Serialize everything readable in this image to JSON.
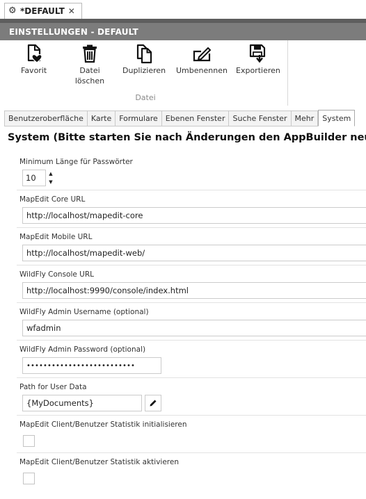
{
  "doc_tab": {
    "title": "*DEFAULT",
    "icon": "gear-icon",
    "close_icon": "close-icon"
  },
  "header": {
    "title": "EINSTELLUNGEN - DEFAULT"
  },
  "ribbon": {
    "group_label": "Datei",
    "buttons": [
      {
        "label": "Favorit",
        "icon": "favorite-document-icon"
      },
      {
        "label": "Datei\nlöschen",
        "icon": "trash-icon"
      },
      {
        "label": "Duplizieren",
        "icon": "duplicate-icon"
      },
      {
        "label": "Umbenennen",
        "icon": "rename-icon"
      },
      {
        "label": "Exportieren",
        "icon": "export-save-icon"
      }
    ]
  },
  "tabs": [
    {
      "label": "Benutzeroberfläche",
      "active": false
    },
    {
      "label": "Karte",
      "active": false
    },
    {
      "label": "Formulare",
      "active": false
    },
    {
      "label": "Ebenen Fenster",
      "active": false
    },
    {
      "label": "Suche Fenster",
      "active": false
    },
    {
      "label": "Mehr",
      "active": false
    },
    {
      "label": "System",
      "active": true
    }
  ],
  "section_title": "System (Bitte starten Sie nach Änderungen den AppBuilder neu)",
  "settings": {
    "min_password_length": {
      "label": "Minimum Länge für Passwörter",
      "value": "10"
    },
    "core_url": {
      "label": "MapEdit Core URL",
      "value": "http://localhost/mapedit-core"
    },
    "mobile_url": {
      "label": "MapEdit Mobile URL",
      "value": "http://localhost/mapedit-web/"
    },
    "wildfly_console_url": {
      "label": "WildFly Console URL",
      "value": "http://localhost:9990/console/index.html"
    },
    "wildfly_admin_username": {
      "label": "WildFly Admin Username (optional)",
      "value": "wfadmin"
    },
    "wildfly_admin_password": {
      "label": "WildFly Admin Password (optional)",
      "value": "••••••••••••••••••••••••••"
    },
    "user_data_path": {
      "label": "Path for User Data",
      "value": "{MyDocuments}",
      "edit_icon": "pencil-icon"
    },
    "stats_init": {
      "label": "MapEdit Client/Benutzer Statistik initialisieren",
      "checked": false
    },
    "stats_active": {
      "label": "MapEdit Client/Benutzer Statistik aktivieren",
      "checked": false
    }
  }
}
